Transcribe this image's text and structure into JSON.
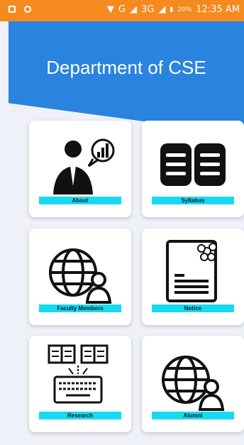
{
  "status_bar": {
    "network": "G",
    "network2": "3G",
    "battery": "20%",
    "time": "12:35 AM"
  },
  "header": {
    "title": "Department of CSE",
    "color": "#2a83de"
  },
  "menu": [
    {
      "label": "About",
      "icon": "person-chart-icon"
    },
    {
      "label": "Syllabus",
      "icon": "book-icon"
    },
    {
      "label": "Faculty Members",
      "icon": "globe-user-icon"
    },
    {
      "label": "Notice",
      "icon": "notice-document-icon"
    },
    {
      "label": "Research",
      "icon": "research-keyboard-icon"
    },
    {
      "label": "Alumni",
      "icon": "globe-user-icon"
    }
  ],
  "colors": {
    "label_bar": "#17d9f2",
    "status_bar": "#f58a1f"
  }
}
